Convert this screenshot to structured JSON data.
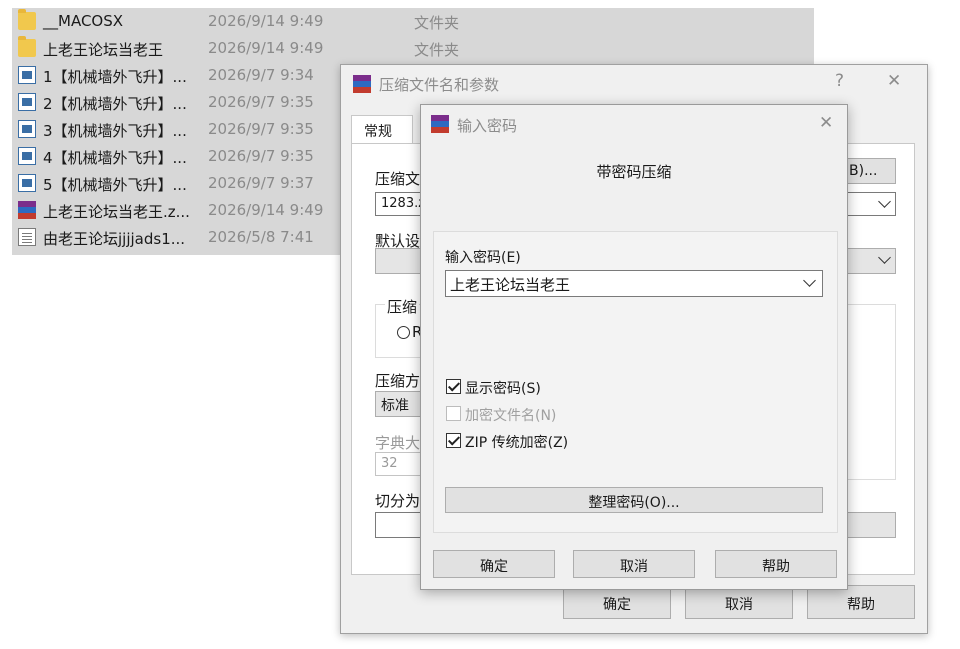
{
  "files": [
    {
      "name": "__MACOSX",
      "date": "2026/9/14 9:49",
      "type": "文件夹",
      "icon": "folder-icon"
    },
    {
      "name": "上老王论坛当老王",
      "date": "2026/9/14 9:49",
      "type": "文件夹",
      "icon": "folder-icon"
    },
    {
      "name": "1【机械墙外飞升】...",
      "date": "2026/9/7 9:34",
      "type": "",
      "icon": "document-icon"
    },
    {
      "name": "2【机械墙外飞升】...",
      "date": "2026/9/7 9:35",
      "type": "",
      "icon": "document-icon"
    },
    {
      "name": "3【机械墙外飞升】...",
      "date": "2026/9/7 9:35",
      "type": "",
      "icon": "document-icon"
    },
    {
      "name": "4【机械墙外飞升】...",
      "date": "2026/9/7 9:35",
      "type": "",
      "icon": "document-icon"
    },
    {
      "name": "5【机械墙外飞升】...",
      "date": "2026/9/7 9:37",
      "type": "",
      "icon": "document-icon"
    },
    {
      "name": "上老王论坛当老王.z...",
      "date": "2026/9/14 9:49",
      "type": "",
      "icon": "winrar-archive-icon"
    },
    {
      "name": "由老王论坛jjjjads1...",
      "date": "2026/5/8 7:41",
      "type": "",
      "icon": "text-file-icon"
    }
  ],
  "archive_dialog": {
    "title": "压缩文件名和参数",
    "help_glyph": "?",
    "close_glyph": "✕",
    "tab_general": "常规",
    "archive_name_label": "压缩文",
    "archive_name_value": "1283.z",
    "browse_button": "B)...",
    "default_profile_label": "默认设",
    "archive_format_label": "压缩",
    "radio_label": "R",
    "compression_method_label": "压缩方",
    "compression_method_value": "标准",
    "dictionary_label": "字典大",
    "dictionary_value": "32",
    "split_label": "切分为",
    "ok_button": "确定",
    "cancel_button": "取消",
    "help_button": "帮助"
  },
  "password_dialog": {
    "title": "输入密码",
    "close_glyph": "✕",
    "heading": "带密码压缩",
    "password_label": "输入密码(E)",
    "password_value": "上老王论坛当老王",
    "show_password_label": "显示密码(S)",
    "show_password_checked": true,
    "encrypt_filenames_label": "加密文件名(N)",
    "encrypt_filenames_checked": false,
    "zip_legacy_label": "ZIP 传统加密(Z)",
    "zip_legacy_checked": true,
    "organize_button": "整理密码(O)...",
    "ok_button": "确定",
    "cancel_button": "取消",
    "help_button": "帮助"
  }
}
